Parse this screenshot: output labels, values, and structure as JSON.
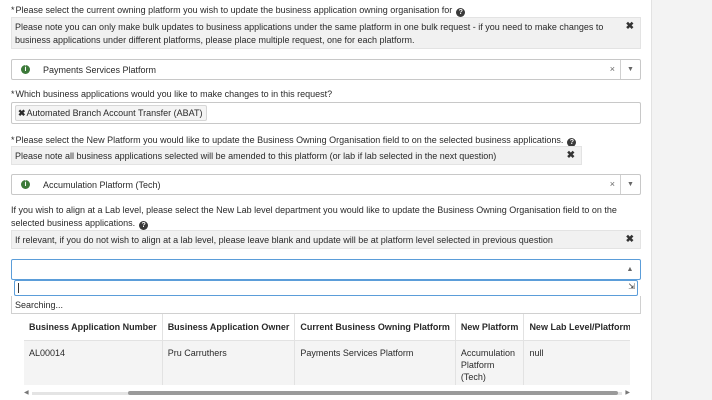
{
  "q1": {
    "required": "*",
    "label": "Please select the current owning platform you wish to update the business application owning organisation for",
    "note": "Please note you can only make bulk updates to business applications under the same platform in one bulk request - if you need to make changes to business applications under different platforms, please place multiple request, one for each platform.",
    "selected": "Payments Services Platform"
  },
  "q2": {
    "required": "*",
    "label": "Which business applications would you like to make changes to in this request?",
    "tag": "Automated Branch Account Transfer (ABAT)"
  },
  "q3": {
    "required": "*",
    "label": "Please select the New Platform you would like to update the Business Owning Organisation field to on the selected business applications.",
    "note": "Please note all business applications selected will be amended to this platform (or lab if lab selected in the next question)",
    "selected": "Accumulation Platform (Tech)"
  },
  "q4": {
    "label_line1": "If you wish to align at a Lab level, please select the New Lab level department you would like to update the Business Owning Organisation field to on the",
    "label_line2": "selected business applications.",
    "note": "If relevant, if you do not wish to align at a lab level, please leave blank and update will be at platform level selected in previous question",
    "search_value": "",
    "searching_text": "Searching..."
  },
  "icons": {
    "help": "?",
    "info": "i",
    "close": "✖",
    "clear": "×",
    "arrow_down": "▼",
    "arrow_up": "▲",
    "tag_remove": "✖"
  },
  "table": {
    "headers": [
      "Business Application Number",
      "Business Application Owner",
      "Current Business Owning Platform",
      "New Platform",
      "New Lab Level/Platform Child"
    ],
    "rows": [
      [
        "AL00014",
        "Pru Carruthers",
        "Payments Services Platform",
        "Accumulation Platform (Tech)",
        "null"
      ]
    ]
  },
  "colors": {
    "accent_focus": "#5b9dd9",
    "info_icon": "#3d7a3a"
  }
}
